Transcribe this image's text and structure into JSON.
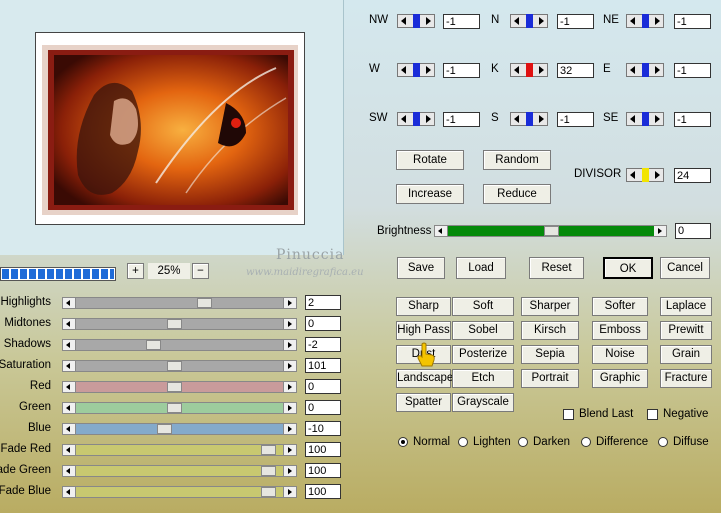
{
  "kernel": [
    {
      "key": "nw",
      "label": "NW",
      "value": "-1",
      "knob": "#1a2cd8"
    },
    {
      "key": "n",
      "label": "N",
      "value": "-1",
      "knob": "#1a2cd8"
    },
    {
      "key": "ne",
      "label": "NE",
      "value": "-1",
      "knob": "#1a2cd8"
    },
    {
      "key": "w",
      "label": "W",
      "value": "-1",
      "knob": "#1a2cd8"
    },
    {
      "key": "k",
      "label": "K",
      "value": "32",
      "knob": "#e01010"
    },
    {
      "key": "e",
      "label": "E",
      "value": "-1",
      "knob": "#1a2cd8"
    },
    {
      "key": "sw",
      "label": "SW",
      "value": "-1",
      "knob": "#1a2cd8"
    },
    {
      "key": "s",
      "label": "S",
      "value": "-1",
      "knob": "#1a2cd8"
    },
    {
      "key": "se",
      "label": "SE",
      "value": "-1",
      "knob": "#1a2cd8"
    }
  ],
  "kernel_buttons": {
    "rotate": "Rotate",
    "random": "Random",
    "increase": "Increase",
    "reduce": "Reduce"
  },
  "divisor": {
    "label": "DIVISOR",
    "value": "24",
    "knob": "#f2e400"
  },
  "brightness": {
    "label": "Brightness",
    "value": "0",
    "level": 0.5,
    "color": "#058a0a"
  },
  "actions": {
    "save": "Save",
    "load": "Load",
    "reset": "Reset",
    "ok": "OK",
    "cancel": "Cancel"
  },
  "zoom": {
    "plus": "+",
    "minus": "−",
    "value": "25%",
    "progress": 1.0
  },
  "watermark": {
    "line1": "Pinuccia",
    "line2": "www.maidiregrafica.eu"
  },
  "sliders": [
    {
      "label": "Highlights",
      "value": "2",
      "level": 0.62,
      "color": "#a8a8a8"
    },
    {
      "label": "Midtones",
      "value": "0",
      "level": 0.47,
      "color": "#a8a8a8"
    },
    {
      "label": "Shadows",
      "value": "-2",
      "level": 0.36,
      "color": "#a8a8a8"
    },
    {
      "label": "Saturation",
      "value": "101",
      "level": 0.47,
      "color": "#a8a8a8"
    },
    {
      "label": "Red",
      "value": "0",
      "level": 0.47,
      "color": "#c99b9b"
    },
    {
      "label": "Green",
      "value": "0",
      "level": 0.47,
      "color": "#9dcc9d"
    },
    {
      "label": "Blue",
      "value": "-10",
      "level": 0.42,
      "color": "#84aacb"
    },
    {
      "label": "Fade Red",
      "value": "100",
      "level": 0.95,
      "color": "#c8c870"
    },
    {
      "label": "Fade Green",
      "value": "100",
      "level": 0.95,
      "color": "#c8c870"
    },
    {
      "label": "Fade Blue",
      "value": "100",
      "level": 0.95,
      "color": "#c8c870"
    }
  ],
  "presets": [
    "Sharp",
    "Soft",
    "Sharper",
    "Softer",
    "Laplace",
    "High Pass",
    "Sobel",
    "Kirsch",
    "Emboss",
    "Prewitt",
    "Dust",
    "Posterize",
    "Sepia",
    "Noise",
    "Grain",
    "Landscape",
    "Etch",
    "Portrait",
    "Graphic",
    "Fracture",
    "Spatter",
    "Grayscale"
  ],
  "checks": {
    "blend_last": "Blend Last",
    "negative": "Negative"
  },
  "modes": [
    {
      "label": "Normal",
      "selected": true
    },
    {
      "label": "Lighten",
      "selected": false
    },
    {
      "label": "Darken",
      "selected": false
    },
    {
      "label": "Difference",
      "selected": false
    },
    {
      "label": "Diffuse",
      "selected": false
    }
  ]
}
